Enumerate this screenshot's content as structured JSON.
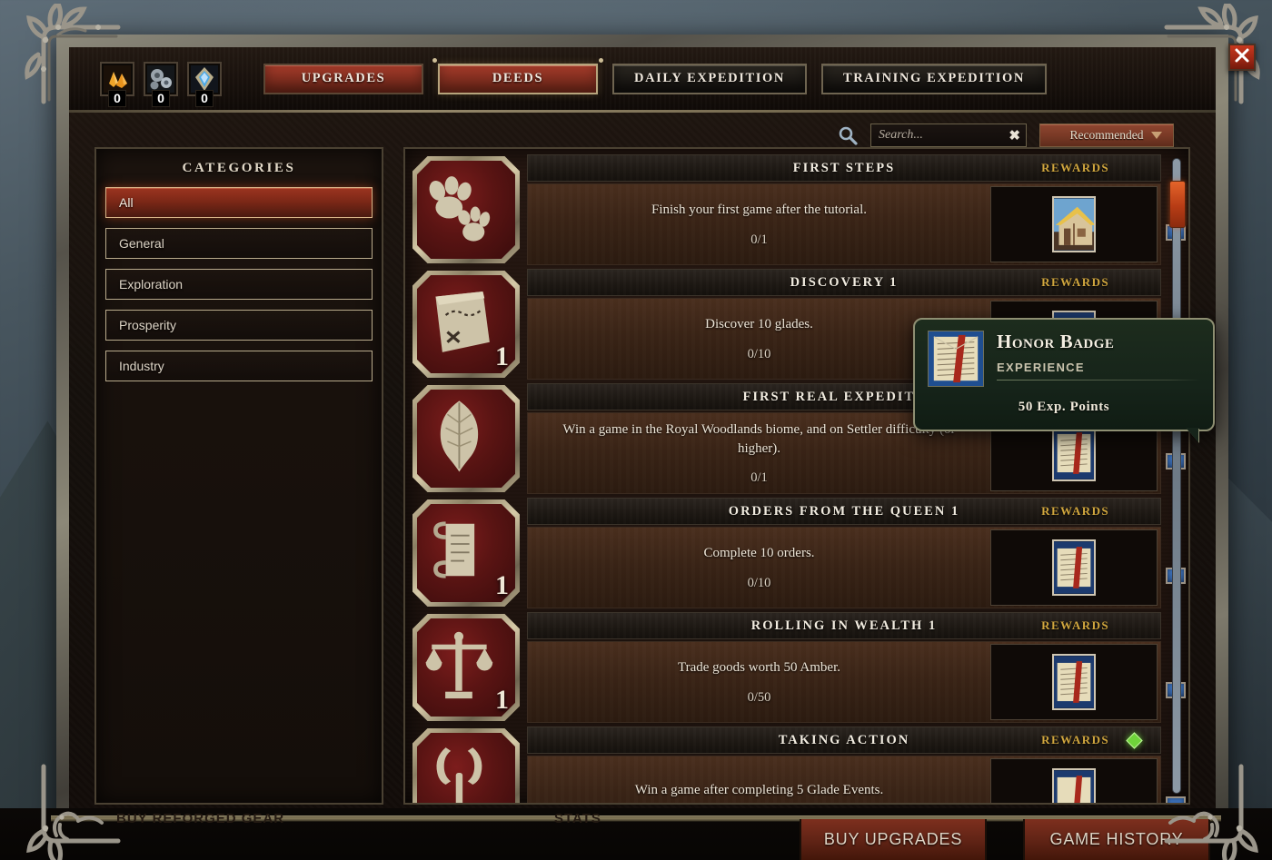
{
  "window": {
    "close_label": "close-window"
  },
  "topbar": {
    "currencies": [
      {
        "icon": "amber-crystal-icon",
        "name": "Amber",
        "count": "0"
      },
      {
        "icon": "machine-parts-icon",
        "name": "Machine Parts",
        "count": "0"
      },
      {
        "icon": "blue-gem-icon",
        "name": "Sealed Ore",
        "count": "0"
      }
    ],
    "tabs": [
      {
        "label": "UPGRADES",
        "style": "red",
        "active": false
      },
      {
        "label": "DEEDS",
        "style": "red",
        "active": true
      },
      {
        "label": "DAILY EXPEDITION",
        "style": "dark",
        "active": false
      },
      {
        "label": "TRAINING EXPEDITION",
        "style": "dark",
        "active": false
      }
    ]
  },
  "search": {
    "placeholder": "Search...",
    "value": "",
    "clear_label": "✖",
    "sort_label": "Recommended"
  },
  "sidebar": {
    "title": "CATEGORIES",
    "items": [
      {
        "label": "All",
        "selected": true
      },
      {
        "label": "General",
        "selected": false
      },
      {
        "label": "Exploration",
        "selected": false
      },
      {
        "label": "Prosperity",
        "selected": false
      },
      {
        "label": "Industry",
        "selected": false
      }
    ]
  },
  "deeds": {
    "rewards_header": "REWARDS",
    "rows": [
      {
        "title": "FIRST STEPS",
        "description": "Finish your first game after the tutorial.",
        "progress": "0/1",
        "tier": "",
        "icon": "paw-prints-icon",
        "reward_icon": "house-icon",
        "has_diamond": false
      },
      {
        "title": "DISCOVERY 1",
        "description": "Discover 10 glades.",
        "progress": "0/10",
        "tier": "1",
        "icon": "treasure-map-icon",
        "reward_icon": "honor-badge-icon",
        "has_diamond": false
      },
      {
        "title": "FIRST REAL EXPEDITION",
        "description": "Win a game in the Royal Woodlands biome, and on Settler difficulty (or higher).",
        "progress": "0/1",
        "tier": "",
        "icon": "oak-leaf-icon",
        "reward_icon": "honor-badge-icon",
        "has_diamond": false
      },
      {
        "title": "ORDERS FROM THE QUEEN 1",
        "description": "Complete 10 orders.",
        "progress": "0/10",
        "tier": "1",
        "icon": "scroll-icon",
        "reward_icon": "honor-badge-icon",
        "has_diamond": false
      },
      {
        "title": "ROLLING IN WEALTH 1",
        "description": "Trade goods worth 50 Amber.",
        "progress": "0/50",
        "tier": "1",
        "icon": "scales-icon",
        "reward_icon": "honor-badge-icon",
        "has_diamond": false
      },
      {
        "title": "TAKING ACTION",
        "description": "Win a game after completing 5 Glade Events.",
        "progress": "",
        "tier": "",
        "icon": "crossed-axes-icon",
        "reward_icon": "honor-badge-icon",
        "has_diamond": true
      }
    ]
  },
  "tooltip": {
    "title": "Honor Badge",
    "category": "EXPERIENCE",
    "value": "50 Exp. Points",
    "icon": "honor-badge-icon"
  },
  "bottombar": {
    "faded_left": "BUY REFORGED GEAR",
    "faded_mid": "STATS",
    "buttons": [
      {
        "label": "BUY UPGRADES"
      },
      {
        "label": "GAME HISTORY"
      }
    ]
  },
  "colors": {
    "accent_red": "#8a3122",
    "gold": "#d0a63e",
    "frame": "#b9ab8c",
    "green_diamond": "#6fd43a"
  }
}
